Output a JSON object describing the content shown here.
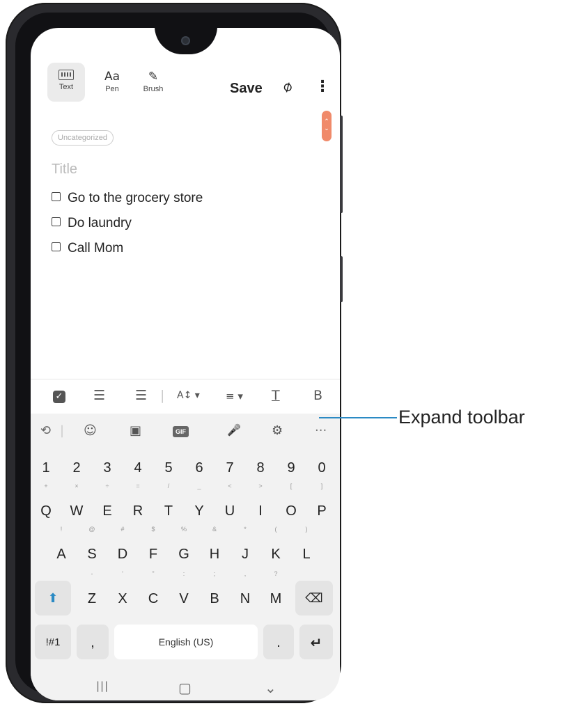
{
  "toolbar": {
    "text_label": "Text",
    "pen_label": "Pen",
    "pen_glyph": "Aa",
    "brush_label": "Brush",
    "brush_glyph": "✎",
    "save_label": "Save",
    "attach_glyph": "⌀",
    "more_glyph": "⋮"
  },
  "note": {
    "category": "Uncategorized",
    "title_placeholder": "Title",
    "items": [
      "Go to the grocery store",
      "Do laundry",
      "Call Mom"
    ]
  },
  "format_bar": {
    "checkbox_glyph": "✓",
    "bullets_glyph": "☰",
    "numbered_glyph": "☰",
    "size_glyph": "A↕ ▾",
    "align_glyph": "≡ ▾",
    "underline_glyph": "T",
    "bold_glyph": "B"
  },
  "keyboard_toolbar": {
    "translate_glyph": "⟲",
    "emoji_glyph": "☺",
    "sticker_glyph": "▣",
    "gif_label": "GIF",
    "mic_glyph": "🎤",
    "settings_glyph": "⚙",
    "expand_glyph": "···"
  },
  "keyboard": {
    "numbers": [
      "1",
      "2",
      "3",
      "4",
      "5",
      "6",
      "7",
      "8",
      "9",
      "0"
    ],
    "row1": [
      "Q",
      "W",
      "E",
      "R",
      "T",
      "Y",
      "U",
      "I",
      "O",
      "P"
    ],
    "row1_sup": [
      "+",
      "×",
      "÷",
      "=",
      "/",
      "_",
      "<",
      ">",
      "[",
      "]"
    ],
    "row2": [
      "A",
      "S",
      "D",
      "F",
      "G",
      "H",
      "J",
      "K",
      "L"
    ],
    "row2_sup": [
      "!",
      "@",
      "#",
      "$",
      "%",
      "&",
      "*",
      "(",
      ")"
    ],
    "row3": [
      "Z",
      "X",
      "C",
      "V",
      "B",
      "N",
      "M"
    ],
    "row3_sup": [
      "-",
      "'",
      "\"",
      ":",
      ";",
      ",",
      "?"
    ],
    "shift_glyph": "⬆",
    "backspace_glyph": "⌫",
    "symbols_label": "!#1",
    "comma_label": ",",
    "space_label": "English (US)",
    "period_label": ".",
    "enter_glyph": "↵"
  },
  "navbar": {
    "recents_glyph": "|||",
    "home_glyph": "▢",
    "back_glyph": "⌄"
  },
  "annotation": {
    "label": "Expand toolbar"
  },
  "colors": {
    "accent_blue": "#2b8ac4",
    "scroll_handle": "#f08a6a"
  }
}
